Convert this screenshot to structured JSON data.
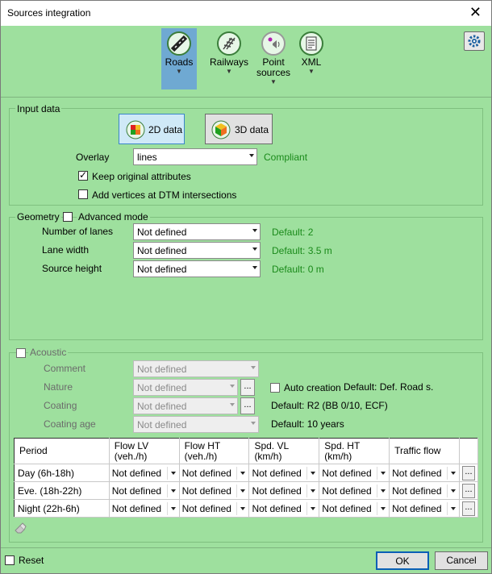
{
  "window": {
    "title": "Sources integration"
  },
  "ribbon": {
    "items": [
      {
        "label": "Roads",
        "label2": ""
      },
      {
        "label": "Railways",
        "label2": ""
      },
      {
        "label": "Point",
        "label2": "sources"
      },
      {
        "label": "XML",
        "label2": ""
      }
    ]
  },
  "input": {
    "group_label": "Input data",
    "btn_2d": "2D data",
    "btn_3d": "3D data",
    "overlay_label": "Overlay",
    "overlay_value": "lines",
    "overlay_status": "Compliant",
    "keep_attr_label": "Keep original attributes",
    "add_vertices_label": "Add vertices at DTM intersections"
  },
  "geometry": {
    "group_label": "Geometry",
    "advanced_label": "Advanced mode",
    "rows": [
      {
        "label": "Number of lanes",
        "value": "Not defined",
        "default": "Default: 2"
      },
      {
        "label": "Lane width",
        "value": "Not defined",
        "default": "Default: 3.5 m"
      },
      {
        "label": "Source height",
        "value": "Not defined",
        "default": "Default: 0 m"
      }
    ]
  },
  "acoustic": {
    "group_label": "Acoustic",
    "comment_label": "Comment",
    "comment_value": "Not defined",
    "nature_label": "Nature",
    "nature_value": "Not defined",
    "auto_creation_label": "Auto creation",
    "nature_default": "Default: Def. Road s.",
    "coating_label": "Coating",
    "coating_value": "Not defined",
    "coating_default": "Default: R2 (BB 0/10, ECF)",
    "coating_age_label": "Coating age",
    "coating_age_value": "Not defined",
    "coating_age_default": "Default: 10 years",
    "more": "..."
  },
  "table": {
    "headers": [
      "Period",
      "Flow LV\n(veh./h)",
      "Flow HT\n(veh./h)",
      "Spd. VL (km/h)",
      "Spd. HT (km/h)",
      "Traffic flow"
    ],
    "rows": [
      {
        "period": "Day (6h-18h)",
        "cells": [
          "Not defined",
          "Not defined",
          "Not defined",
          "Not defined",
          "Not defined"
        ]
      },
      {
        "period": "Eve. (18h-22h)",
        "cells": [
          "Not defined",
          "Not defined",
          "Not defined",
          "Not defined",
          "Not defined"
        ]
      },
      {
        "period": "Night (22h-6h)",
        "cells": [
          "Not defined",
          "Not defined",
          "Not defined",
          "Not defined",
          "Not defined"
        ]
      }
    ],
    "row_button": "..."
  },
  "footer": {
    "reset_label": "Reset",
    "ok_label": "OK",
    "cancel_label": "Cancel"
  },
  "colors": {
    "background": "#9ee09e",
    "selected": "#6fa9d2",
    "status_green": "#1a8a1a"
  },
  "icons": [
    "close-icon",
    "road-icon",
    "railway-icon",
    "point-source-icon",
    "xml-icon",
    "settings-gear-icon",
    "2d-layers-icon",
    "3d-cube-icon",
    "eraser-icon"
  ]
}
